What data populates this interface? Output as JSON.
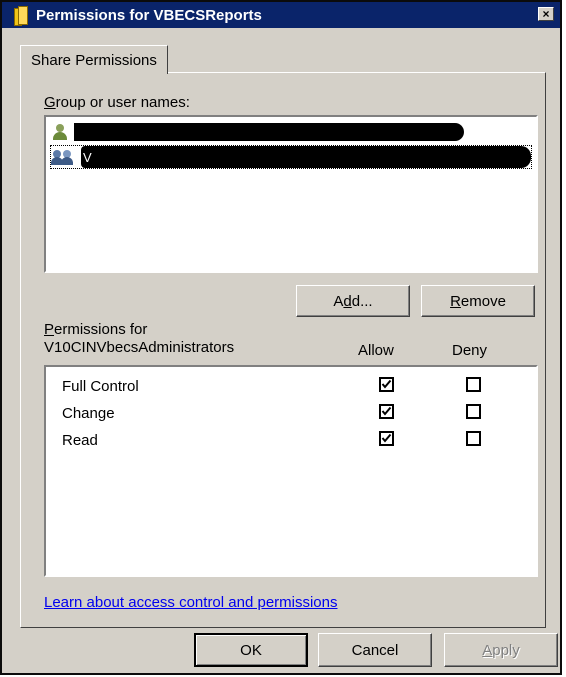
{
  "window": {
    "title": "Permissions for VBECSReports",
    "close_label": "×"
  },
  "tabs": [
    {
      "label": "Share Permissions"
    }
  ],
  "group_names": {
    "label_accel": "G",
    "label_rest": "roup or user names:",
    "items": [
      {
        "icon": "user-icon",
        "text": ""
      },
      {
        "icon": "group-icon",
        "text": "V"
      }
    ]
  },
  "buttons": {
    "add": {
      "before": "A",
      "accel": "d",
      "after": "d..."
    },
    "remove": {
      "accel": "R",
      "after": "emove"
    },
    "ok": "OK",
    "cancel": "Cancel",
    "apply": {
      "accel": "A",
      "after": "pply"
    }
  },
  "permissions": {
    "label_accel": "P",
    "label_line1_rest": "ermissions for",
    "label_line2": "V10CINVbecsAdministrators",
    "allow_header": "Allow",
    "deny_header": "Deny",
    "rows": [
      {
        "name": "Full Control",
        "allow": true,
        "deny": false
      },
      {
        "name": "Change",
        "allow": true,
        "deny": false
      },
      {
        "name": "Read",
        "allow": true,
        "deny": false
      }
    ]
  },
  "help_link": "Learn about access control and permissions"
}
